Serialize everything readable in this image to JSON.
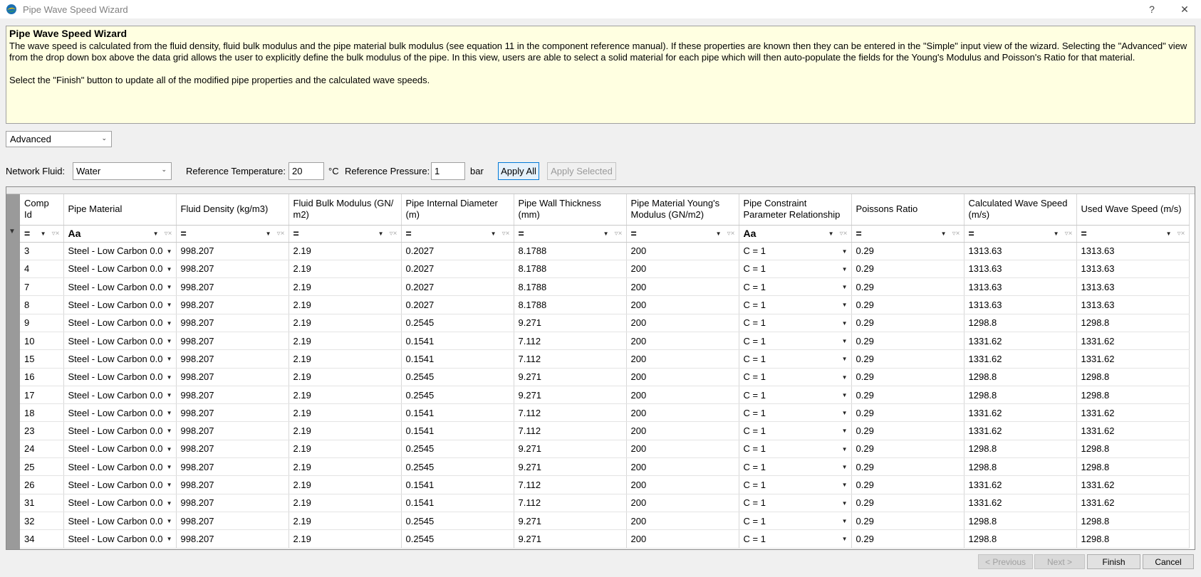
{
  "window": {
    "title": "Pipe Wave Speed Wizard",
    "help": "?",
    "close": "✕"
  },
  "info": {
    "title": "Pipe Wave Speed Wizard",
    "paragraph1": "The wave speed is calculated from the fluid density, fluid bulk modulus and the pipe material bulk modulus (see equation 11 in the component reference manual). If these properties are known then they can be entered in the \"Simple\" input view of the wizard. Selecting the \"Advanced\" view from the drop down box above the data grid allows the user to explicitly define the bulk modulus of the pipe. In this view, users are able to select a solid material for each pipe which will then auto-populate the fields for the Young's Modulus and Poisson's Ratio for that material.",
    "paragraph2": "Select the \"Finish\" button to update all of the modified pipe properties and the calculated wave speeds."
  },
  "view_select": {
    "value": "Advanced"
  },
  "fluid": {
    "network_fluid_label": "Network Fluid:",
    "network_fluid_value": "Water",
    "ref_temp_label": "Reference Temperature:",
    "ref_temp_value": "20",
    "ref_temp_unit": "°C",
    "ref_press_label": "Reference Pressure:",
    "ref_press_value": "1",
    "ref_press_unit": "bar",
    "apply_all": "Apply All",
    "apply_selected": "Apply Selected"
  },
  "grid": {
    "headers": [
      "Comp Id",
      "Pipe Material",
      "Fluid Density (kg/m3)",
      "Fluid Bulk Modulus (GN/ m2)",
      "Pipe Internal Diameter (m)",
      "Pipe Wall Thickness (mm)",
      "Pipe Material Young's Modulus (GN/m2)",
      "Pipe Constraint Parameter Relationship",
      "Poissons Ratio",
      "Calculated Wave Speed (m/s)",
      "Used Wave Speed (m/s)"
    ],
    "filter_ops": [
      "=",
      "Aa",
      "=",
      "=",
      "=",
      "=",
      "=",
      "Aa",
      "=",
      "=",
      "="
    ],
    "rows": [
      [
        "3",
        "Steel - Low Carbon 0.0",
        "998.207",
        "2.19",
        "0.2027",
        "8.1788",
        "200",
        "C = 1",
        "0.29",
        "1313.63",
        "1313.63"
      ],
      [
        "4",
        "Steel - Low Carbon 0.0",
        "998.207",
        "2.19",
        "0.2027",
        "8.1788",
        "200",
        "C = 1",
        "0.29",
        "1313.63",
        "1313.63"
      ],
      [
        "7",
        "Steel - Low Carbon 0.0",
        "998.207",
        "2.19",
        "0.2027",
        "8.1788",
        "200",
        "C = 1",
        "0.29",
        "1313.63",
        "1313.63"
      ],
      [
        "8",
        "Steel - Low Carbon 0.0",
        "998.207",
        "2.19",
        "0.2027",
        "8.1788",
        "200",
        "C = 1",
        "0.29",
        "1313.63",
        "1313.63"
      ],
      [
        "9",
        "Steel - Low Carbon 0.0",
        "998.207",
        "2.19",
        "0.2545",
        "9.271",
        "200",
        "C = 1",
        "0.29",
        "1298.8",
        "1298.8"
      ],
      [
        "10",
        "Steel - Low Carbon 0.0",
        "998.207",
        "2.19",
        "0.1541",
        "7.112",
        "200",
        "C = 1",
        "0.29",
        "1331.62",
        "1331.62"
      ],
      [
        "15",
        "Steel - Low Carbon 0.0",
        "998.207",
        "2.19",
        "0.1541",
        "7.112",
        "200",
        "C = 1",
        "0.29",
        "1331.62",
        "1331.62"
      ],
      [
        "16",
        "Steel - Low Carbon 0.0",
        "998.207",
        "2.19",
        "0.2545",
        "9.271",
        "200",
        "C = 1",
        "0.29",
        "1298.8",
        "1298.8"
      ],
      [
        "17",
        "Steel - Low Carbon 0.0",
        "998.207",
        "2.19",
        "0.2545",
        "9.271",
        "200",
        "C = 1",
        "0.29",
        "1298.8",
        "1298.8"
      ],
      [
        "18",
        "Steel - Low Carbon 0.0",
        "998.207",
        "2.19",
        "0.1541",
        "7.112",
        "200",
        "C = 1",
        "0.29",
        "1331.62",
        "1331.62"
      ],
      [
        "23",
        "Steel - Low Carbon 0.0",
        "998.207",
        "2.19",
        "0.1541",
        "7.112",
        "200",
        "C = 1",
        "0.29",
        "1331.62",
        "1331.62"
      ],
      [
        "24",
        "Steel - Low Carbon 0.0",
        "998.207",
        "2.19",
        "0.2545",
        "9.271",
        "200",
        "C = 1",
        "0.29",
        "1298.8",
        "1298.8"
      ],
      [
        "25",
        "Steel - Low Carbon 0.0",
        "998.207",
        "2.19",
        "0.2545",
        "9.271",
        "200",
        "C = 1",
        "0.29",
        "1298.8",
        "1298.8"
      ],
      [
        "26",
        "Steel - Low Carbon 0.0",
        "998.207",
        "2.19",
        "0.1541",
        "7.112",
        "200",
        "C = 1",
        "0.29",
        "1331.62",
        "1331.62"
      ],
      [
        "31",
        "Steel - Low Carbon 0.0",
        "998.207",
        "2.19",
        "0.1541",
        "7.112",
        "200",
        "C = 1",
        "0.29",
        "1331.62",
        "1331.62"
      ],
      [
        "32",
        "Steel - Low Carbon 0.0",
        "998.207",
        "2.19",
        "0.2545",
        "9.271",
        "200",
        "C = 1",
        "0.29",
        "1298.8",
        "1298.8"
      ],
      [
        "34",
        "Steel - Low Carbon 0.0",
        "998.207",
        "2.19",
        "0.2545",
        "9.271",
        "200",
        "C = 1",
        "0.29",
        "1298.8",
        "1298.8"
      ]
    ]
  },
  "footer": {
    "previous": "< Previous",
    "next": "Next >",
    "finish": "Finish",
    "cancel": "Cancel"
  }
}
